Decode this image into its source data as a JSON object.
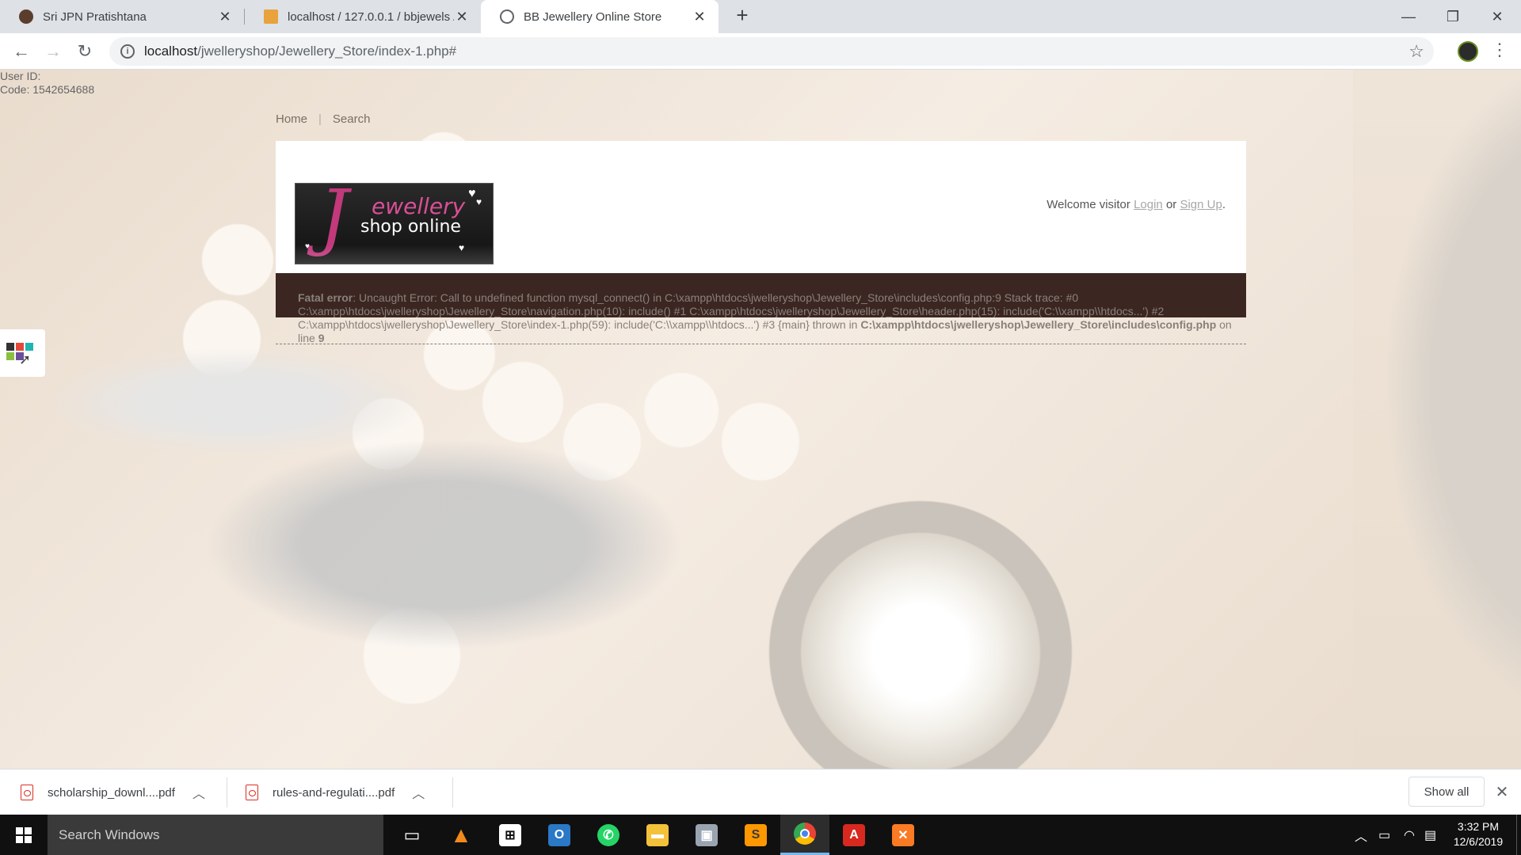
{
  "browser": {
    "tabs": [
      {
        "title": "Sri JPN Pratishtana",
        "active": false
      },
      {
        "title": "localhost / 127.0.0.1 / bbjewels /",
        "active": false
      },
      {
        "title": "BB Jewellery Online Store",
        "active": true
      }
    ],
    "url_host": "localhost",
    "url_path": "/jwelleryshop/Jewellery_Store/index-1.php#"
  },
  "page": {
    "user_id_label": "User ID:",
    "code_label": "Code:",
    "code_value": "1542654688",
    "nav": {
      "home": "Home",
      "separator": "|",
      "search": "Search"
    },
    "logo": {
      "letter": "J",
      "word1": "ewellery",
      "word2": "shop online"
    },
    "welcome": {
      "prefix": "Welcome visitor",
      "login": "Login",
      "or": "or",
      "signup": "Sign Up",
      "suffix": "."
    },
    "error": {
      "label": "Fatal error",
      "message": ": Uncaught Error: Call to undefined function mysql_connect() in C:\\xampp\\htdocs\\jwelleryshop\\Jewellery_Store\\includes\\config.php:9 Stack trace: #0 C:\\xampp\\htdocs\\jwelleryshop\\Jewellery_Store\\navigation.php(10): include() #1 C:\\xampp\\htdocs\\jwelleryshop\\Jewellery_Store\\header.php(15): include('C:\\\\xampp\\\\htdocs...') #2 C:\\xampp\\htdocs\\jwelleryshop\\Jewellery_Store\\index-1.php(59): include('C:\\\\xampp\\\\htdocs...') #3 {main} thrown in ",
      "file": "C:\\xampp\\htdocs\\jwelleryshop\\Jewellery_Store\\includes\\config.php",
      "on_line": " on line ",
      "line": "9"
    }
  },
  "downloads": {
    "items": [
      {
        "name": "scholarship_downl....pdf"
      },
      {
        "name": "rules-and-regulati....pdf"
      }
    ],
    "show_all": "Show all"
  },
  "taskbar": {
    "search_placeholder": "Search Windows",
    "time": "3:32 PM",
    "date": "12/6/2019"
  },
  "colors": {
    "error_bar": "#3b2622",
    "header_bg": "#ffffff",
    "logo_pink": "#c2397c",
    "taskbar": "#101010"
  }
}
